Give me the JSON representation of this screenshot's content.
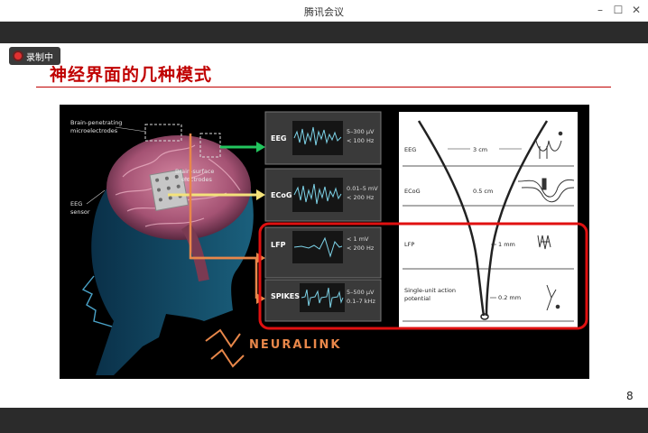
{
  "window": {
    "title": "腾讯会议",
    "minimize": "–",
    "maximize": "☐",
    "close": "✕"
  },
  "recording": {
    "label": "录制中"
  },
  "slide": {
    "title": "神经界面的几种模式",
    "page_number": "8",
    "figure": {
      "labels": {
        "brain_penetrating": "Brain-penetrating",
        "microelectrodes": "microelectrodes",
        "brain_surface": "Brain-surface",
        "electrodes": "electrodes",
        "eeg_sensor_1": "EEG",
        "eeg_sensor_2": "sensor"
      },
      "signals": [
        {
          "name": "EEG",
          "line1": "5–300 µV",
          "line2": "< 100 Hz"
        },
        {
          "name": "ECoG",
          "line1": "0.01–5 mV",
          "line2": "< 200 Hz"
        },
        {
          "name": "LFP",
          "line1": "< 1 mV",
          "line2": "< 200 Hz"
        },
        {
          "name": "SPIKES",
          "line1": "5–500 µV",
          "line2": "0.1–7 kHz"
        }
      ],
      "logo": "NEURALINK",
      "diagram": {
        "rows": [
          {
            "name": "EEG",
            "dist": "3 cm"
          },
          {
            "name": "ECoG",
            "dist": "0.5 cm"
          },
          {
            "name": "LFP",
            "dist": "1 mm"
          },
          {
            "name_line1": "Single-unit action",
            "name_line2": "potential",
            "dist": "0.2 mm"
          }
        ]
      }
    }
  },
  "colors": {
    "accent_red": "#c00000",
    "arrow_green": "#22c55e",
    "arrow_yellow": "#f3e27a",
    "arrow_orange": "#e8874a",
    "highlight_red": "#e01010"
  }
}
